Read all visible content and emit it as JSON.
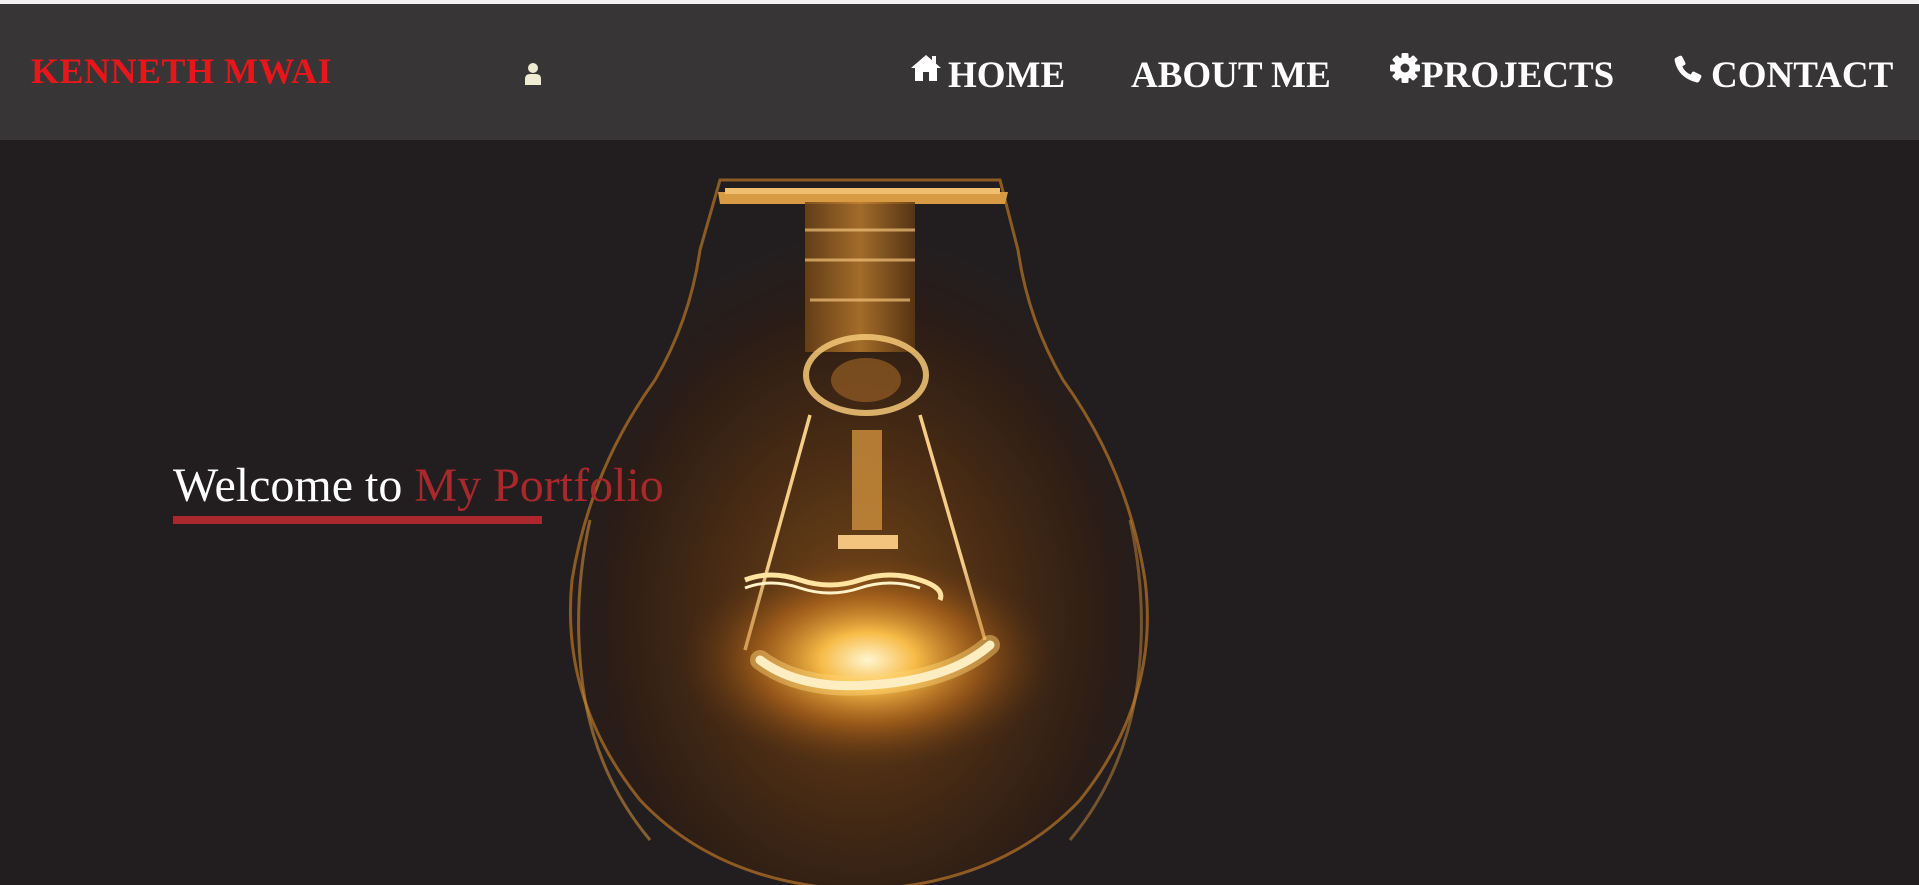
{
  "brand": {
    "name": "KENNETH MWAI",
    "color": "#e8161b"
  },
  "header": {
    "user_icon": "user-icon",
    "background": "#373536"
  },
  "nav": {
    "items": [
      {
        "label": "HOME",
        "icon": "home-icon"
      },
      {
        "label": "ABOUT ME",
        "icon": ""
      },
      {
        "label": "PROJECTS",
        "icon": "gear-icon"
      },
      {
        "label": "CONTACT",
        "icon": "phone-icon"
      }
    ]
  },
  "hero": {
    "welcome_lead": "Welcome to ",
    "welcome_accent": "My Portfolio",
    "accent_color": "#a8282c",
    "image": "light-bulb-photo",
    "background": "#221e20"
  }
}
